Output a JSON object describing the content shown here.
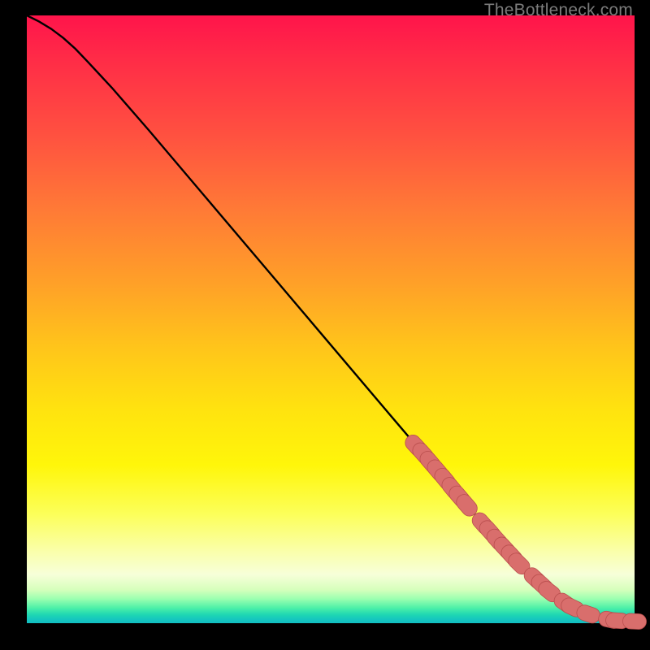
{
  "watermark": {
    "text": "TheBottleneck.com"
  },
  "palette": {
    "marker_fill": "#d96e6c",
    "marker_stroke": "#b94e4d",
    "line": "#000000"
  },
  "chart_data": {
    "type": "line",
    "title": "",
    "xlabel": "",
    "ylabel": "",
    "xlim": [
      0,
      100
    ],
    "ylim": [
      0,
      100
    ],
    "grid": false,
    "legend": false,
    "annotations": [],
    "series": [
      {
        "name": "curve",
        "x": [
          0,
          2,
          4,
          6,
          8,
          10,
          14,
          20,
          30,
          40,
          50,
          60,
          68,
          72,
          76,
          80,
          84,
          88,
          90,
          92,
          94,
          96,
          98,
          100
        ],
        "y": [
          100,
          99,
          97.8,
          96.3,
          94.5,
          92.4,
          88.1,
          81.2,
          69.4,
          57.6,
          45.8,
          34.0,
          24.6,
          19.9,
          15.3,
          10.8,
          7.0,
          3.8,
          2.6,
          1.7,
          1.0,
          0.6,
          0.35,
          0.3
        ]
      }
    ],
    "markers": [
      {
        "x": 64.0,
        "y": 29.2
      },
      {
        "x": 65.2,
        "y": 27.9
      },
      {
        "x": 66.4,
        "y": 26.5
      },
      {
        "x": 67.6,
        "y": 25.1
      },
      {
        "x": 68.8,
        "y": 23.7
      },
      {
        "x": 70.0,
        "y": 22.2
      },
      {
        "x": 71.2,
        "y": 20.8
      },
      {
        "x": 72.4,
        "y": 19.4
      },
      {
        "x": 75.0,
        "y": 16.4
      },
      {
        "x": 76.2,
        "y": 15.1
      },
      {
        "x": 77.4,
        "y": 13.7
      },
      {
        "x": 78.6,
        "y": 12.4
      },
      {
        "x": 79.8,
        "y": 11.1
      },
      {
        "x": 81.0,
        "y": 9.8
      },
      {
        "x": 83.6,
        "y": 7.4
      },
      {
        "x": 84.8,
        "y": 6.3
      },
      {
        "x": 86.0,
        "y": 5.2
      },
      {
        "x": 88.6,
        "y": 3.3
      },
      {
        "x": 89.8,
        "y": 2.6
      },
      {
        "x": 92.4,
        "y": 1.5
      },
      {
        "x": 96.0,
        "y": 0.55
      },
      {
        "x": 97.2,
        "y": 0.42
      },
      {
        "x": 100.0,
        "y": 0.3
      }
    ]
  }
}
